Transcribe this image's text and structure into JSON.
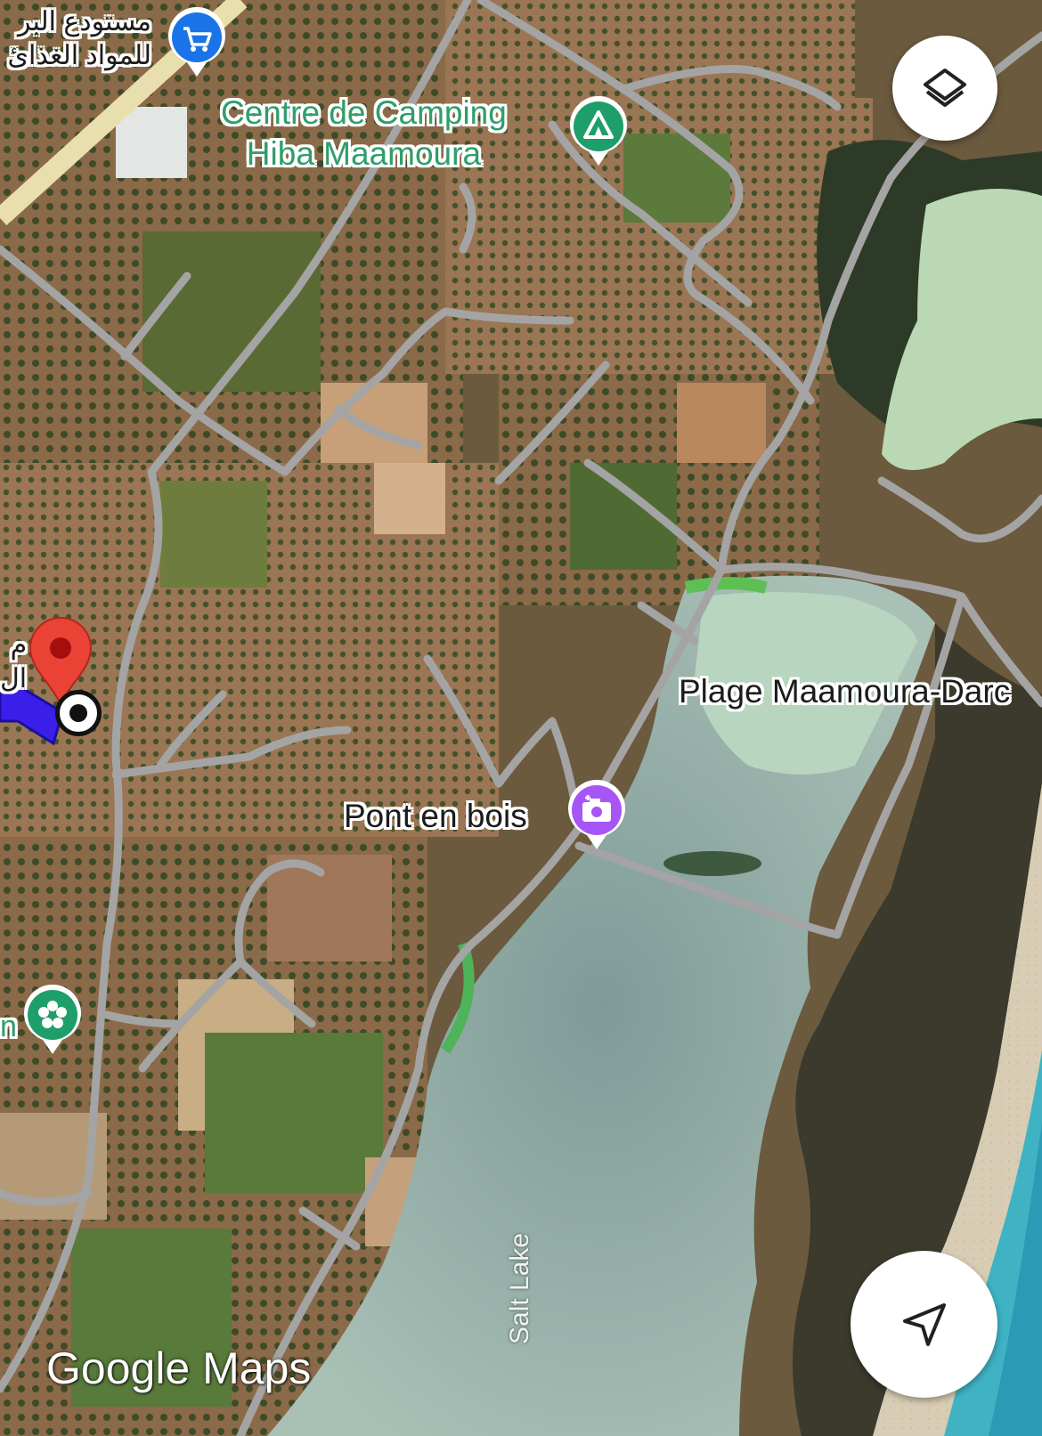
{
  "map": {
    "type": "satellite",
    "places": {
      "camping": {
        "name_line1": "Centre de Camping",
        "name_line2": "Hiba Maamoura",
        "icon": "camping-tent-icon",
        "color": "#1e9e6a"
      },
      "beach": {
        "name": "Plage Maamoura-Darc"
      },
      "bridge": {
        "name": "Pont en bois",
        "icon": "photo-camera-icon",
        "color": "#a855f7"
      },
      "store": {
        "name_line1": "مستودع البر",
        "name_line2": "للمواد الغذائ",
        "icon": "shopping-cart-icon",
        "color": "#1a73e8"
      },
      "flower_poi": {
        "name": "n",
        "icon": "flower-icon",
        "color": "#1e9e6a"
      },
      "edge_label": {
        "line1": "م",
        "line2": "ال"
      },
      "lake": {
        "name": "Salt Lake"
      }
    },
    "selected_pin": {
      "icon": "red-location-pin-icon",
      "color": "#ea4335"
    },
    "route": {
      "color": "#3b1fe8"
    },
    "watermark": "Google Maps"
  },
  "controls": {
    "layers_button": {
      "icon": "layers-icon"
    },
    "my_location_button": {
      "icon": "navigation-arrow-icon"
    }
  }
}
